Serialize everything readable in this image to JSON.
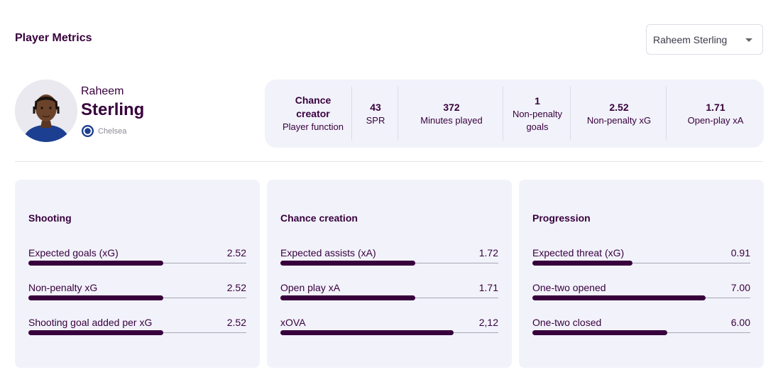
{
  "header": {
    "title": "Player Metrics"
  },
  "player_select": {
    "selected": "Raheem Sterling"
  },
  "player": {
    "first_name": "Raheem",
    "last_name": "Sterling",
    "club": "Chelsea"
  },
  "colors": {
    "accent": "#37003c",
    "panel": "#f2f2fb"
  },
  "summary": [
    {
      "value": "Chance creator",
      "label": "Player function"
    },
    {
      "value": "43",
      "label": "SPR"
    },
    {
      "value": "372",
      "label": "Minutes played"
    },
    {
      "value": "1",
      "label": "Non-penalty goals"
    },
    {
      "value": "2.52",
      "label": "Non-penalty xG"
    },
    {
      "value": "1.71",
      "label": "Open-play xA"
    }
  ],
  "cards": [
    {
      "title": "Shooting",
      "metrics": [
        {
          "label": "Expected goals (xG)",
          "value": "2.52",
          "fill": 0.62
        },
        {
          "label": "Non-penalty xG",
          "value": "2.52",
          "fill": 0.62
        },
        {
          "label": "Shooting goal added per xG",
          "value": "2.52",
          "fill": 0.62
        }
      ]
    },
    {
      "title": "Chance creation",
      "metrics": [
        {
          "label": "Expected assists (xA)",
          "value": "1.72",
          "fill": 0.62
        },
        {
          "label": "Open play xA",
          "value": "1.71",
          "fill": 0.62
        },
        {
          "label": "xOVA",
          "value": "2,12",
          "fill": 0.795
        }
      ]
    },
    {
      "title": "Progression",
      "metrics": [
        {
          "label": "Expected threat (xG)",
          "value": "0.91",
          "fill": 0.46
        },
        {
          "label": "One-two opened",
          "value": "7.00",
          "fill": 0.795
        },
        {
          "label": "One-two closed",
          "value": "6.00",
          "fill": 0.62
        }
      ]
    }
  ]
}
